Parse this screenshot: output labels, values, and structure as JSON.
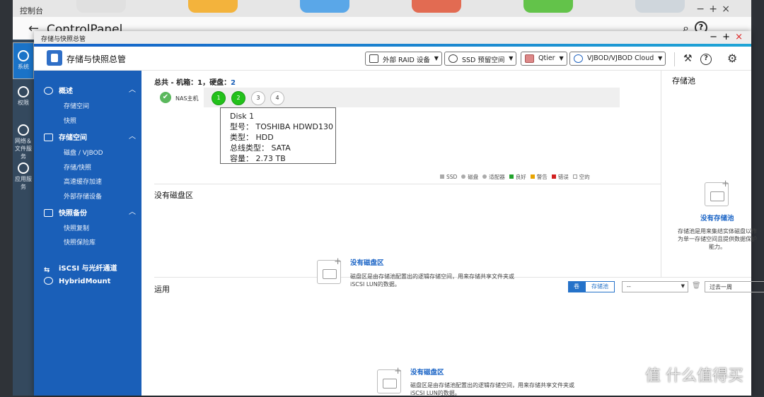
{
  "bg_window": {
    "title": "控制台",
    "app_title": "ControlPanel",
    "sidebar": [
      "系统",
      "权限",
      "网络＆文件服务",
      "应用服务"
    ]
  },
  "window": {
    "title": "存储与快照总管",
    "app_title": "存储与快照总管",
    "controls": {
      "min": "−",
      "max": "+",
      "close": "×"
    }
  },
  "header": {
    "buttons": [
      {
        "label": "外部 RAID 设备"
      },
      {
        "label": "SSD 预留空间"
      },
      {
        "label": "Qtier"
      },
      {
        "label": "VJBOD/VJBOD Cloud"
      }
    ],
    "help": "?"
  },
  "nav": {
    "sections": [
      {
        "label": "概述",
        "items": [
          "存储空间",
          "快照"
        ]
      },
      {
        "label": "存储空间",
        "items": [
          "磁盘 / VJBOD",
          "存储/快照",
          "高速缓存加速",
          "外部存储设备"
        ]
      },
      {
        "label": "快照备份",
        "items": [
          "快照复制",
          "快照保险库"
        ]
      }
    ],
    "extra": [
      "iSCSI 与光纤通道",
      "HybridMount"
    ]
  },
  "summary": {
    "label": "总共 - 机箱：1，硬盘：",
    "count": "2",
    "nas_label": "NAS主机",
    "disks": [
      "1",
      "2",
      "3",
      "4"
    ],
    "disk_status": [
      "ok",
      "ok",
      "empty",
      "empty"
    ]
  },
  "tooltip": {
    "title": "Disk 1",
    "model": "型号：  TOSHIBA HDWD130",
    "type": "类型：  HDD",
    "bus": "总线类型：  SATA",
    "capacity": "容量：  2.73 TB"
  },
  "legend": [
    {
      "label": "SSD",
      "color": "#aaaaaa",
      "shape": "square"
    },
    {
      "label": "磁盘",
      "color": "#aaaaaa",
      "shape": "circle"
    },
    {
      "label": "适配器",
      "color": "#aaaaaa",
      "shape": "circle"
    },
    {
      "label": "良好",
      "color": "#22a32c",
      "shape": "square"
    },
    {
      "label": "警告",
      "color": "#e8a400",
      "shape": "square"
    },
    {
      "label": "错误",
      "color": "#d22020",
      "shape": "square"
    },
    {
      "label": "空的",
      "color": "#ffffff",
      "shape": "square"
    }
  ],
  "disk_group": {
    "title": "没有磁盘区",
    "empty_link": "没有磁盘区",
    "desc1": "磁盘区是由存储池配置出的逻辑存储空间，用来存储共享文件夹或",
    "desc2": "iSCSI LUN的数据。"
  },
  "storage_pool": {
    "title": "存储池",
    "empty_link": "没有存储池",
    "desc1": "存储池是用来集结实体磁盘以作",
    "desc2": "为单一存储空间且提供数据保护",
    "desc3": "能力。"
  },
  "usage": {
    "title": "运用",
    "seg_volume": "卷",
    "seg_pool": "存储池",
    "select1": "--",
    "select2": "过去一周",
    "empty_link": "没有磁盘区",
    "desc1": "磁盘区是由存储池配置出的逻辑存储空间，用来存储共享文件夹或",
    "desc2": "iSCSI LUN的数据。"
  },
  "watermark": "值 什么值得买"
}
